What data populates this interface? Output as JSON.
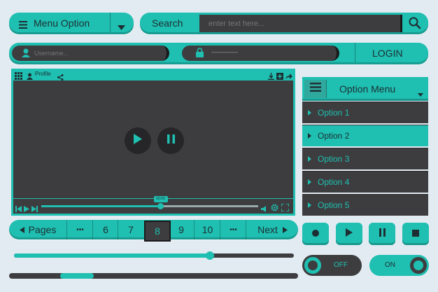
{
  "menu": {
    "label": "Menu Option",
    "icon": "hamburger-icon",
    "dropdown_icon": "chevron-down-icon"
  },
  "search": {
    "label": "Search",
    "placeholder": "enter text here...",
    "icon": "search-icon"
  },
  "login": {
    "username_placeholder": "Username...",
    "password_placeholder": "••••••••••••••••••",
    "button_label": "LOGIN"
  },
  "player": {
    "toolbar_label": "Profile",
    "time_label": "00:00",
    "progress": 0.55
  },
  "option_menu": {
    "title": "Option Menu",
    "items": [
      {
        "label": "Option 1",
        "selected": false
      },
      {
        "label": "Option 2",
        "selected": true
      },
      {
        "label": "Option 3",
        "selected": false
      },
      {
        "label": "Option 4",
        "selected": false
      },
      {
        "label": "Option 5",
        "selected": false
      }
    ]
  },
  "pagination": {
    "prev_label": "Pages",
    "next_label": "Next",
    "ellipsis": "•••",
    "pages": [
      "6",
      "7",
      "8",
      "9",
      "10"
    ],
    "current": "8"
  },
  "sliders": {
    "slider1_value": 0.7,
    "scrollbar_position": 0.2
  },
  "toggles": {
    "off_label": "OFF",
    "on_label": "ON"
  },
  "colors": {
    "accent": "#1fbfb1",
    "dark": "#3d3d3f",
    "background": "#e3ebf2"
  }
}
